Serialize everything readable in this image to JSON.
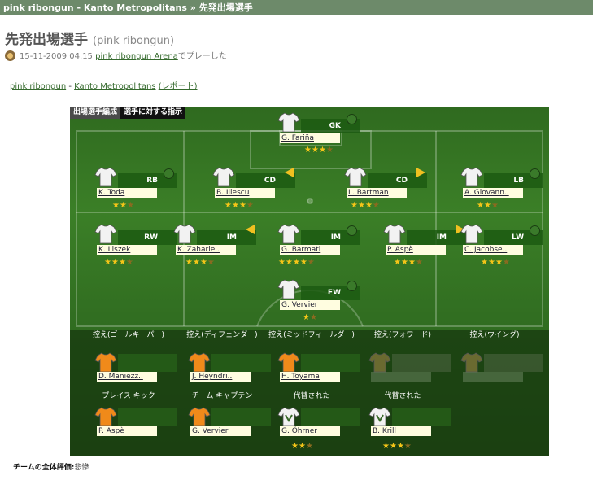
{
  "header": {
    "title": "pink ribongun - Kanto Metropolitans » 先発出場選手"
  },
  "page": {
    "title": "先発出場選手",
    "subtitle": "(pink ribongun)"
  },
  "meta": {
    "datetime": "15-11-2009 04.15",
    "arena": "pink ribongun Arena",
    "suffix": "でプレーした"
  },
  "breadcrumb": {
    "team": "pink ribongun",
    "sep": " - ",
    "opponent": "Kanto Metropolitans",
    "report": "(レポート)"
  },
  "tabs": {
    "lineup": "出場選手編成",
    "instructions": "選手に対する指示"
  },
  "players": [
    {
      "pos": "GK",
      "name": "G. Fariña",
      "stars": 3.5,
      "indicator": "dot"
    },
    {
      "pos": "RB",
      "name": "K. Toda",
      "stars": 2.5,
      "indicator": "dot"
    },
    {
      "pos": "CD",
      "name": "B. Iliescu",
      "stars": 3.5,
      "indicator": "left"
    },
    {
      "pos": "CD",
      "name": "L. Bartman",
      "stars": 3.5,
      "indicator": "right"
    },
    {
      "pos": "LB",
      "name": "A. Giovann..",
      "stars": 2.5,
      "indicator": "dot"
    },
    {
      "pos": "RW",
      "name": "K. Liszek",
      "stars": 3.5,
      "indicator": "none"
    },
    {
      "pos": "IM",
      "name": "K. Zaharie..",
      "stars": 3.5,
      "indicator": "left"
    },
    {
      "pos": "IM",
      "name": "G. Barmati",
      "stars": 4.5,
      "indicator": "dot"
    },
    {
      "pos": "IM",
      "name": "P. Aspè",
      "stars": 3.5,
      "indicator": "right"
    },
    {
      "pos": "LW",
      "name": "C. Jacobse..",
      "stars": 3.5,
      "indicator": "dot"
    },
    {
      "pos": "FW",
      "name": "G. Vervier",
      "stars": 1.5,
      "indicator": "dot"
    }
  ],
  "bench": [
    {
      "label": "控え(ゴールキーパー)",
      "name": "D. Maniezz.."
    },
    {
      "label": "控え(ディフェンダー)",
      "name": "J. Heyndri.."
    },
    {
      "label": "控え(ミッドフィールダー)",
      "name": "H. Toyama"
    },
    {
      "label": "控え(フォワード)",
      "name": ""
    },
    {
      "label": "控え(ウイング)",
      "name": ""
    }
  ],
  "specials": [
    {
      "label": "プレイス キック",
      "name": "P. Aspè",
      "stars": 0
    },
    {
      "label": "チーム キャプテン",
      "name": "G. Vervier",
      "stars": 0
    },
    {
      "label": "代替された",
      "name": "G. Öhrner",
      "stars": 2.5
    },
    {
      "label": "代替された",
      "name": "B. Krill",
      "stars": 3.5
    }
  ],
  "team_rating": {
    "label": "チームの全体評価:",
    "value": "悲惨"
  },
  "colors": {
    "header_bg": "#6d8a6a",
    "pitch": "#3b7f27",
    "link": "#356a2d",
    "star": "#f5c518",
    "keeper_shirt": "#f08a1a"
  }
}
